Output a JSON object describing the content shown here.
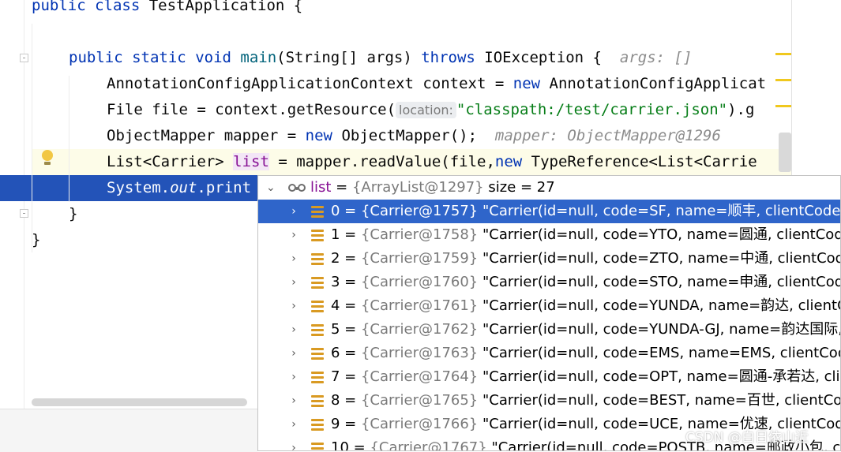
{
  "editor": {
    "line1": {
      "kw1": "public",
      "kw2": "class",
      "rest": " TestApplication {"
    },
    "line3": {
      "kw1": "public",
      "kw2": "static",
      "kw3": "void",
      "method": "main",
      "params": "(String[] args) ",
      "kw4": "throws",
      "rest": " IOException {",
      "hint": "args: []"
    },
    "line4": {
      "a": "AnnotationConfigApplicationContext context = ",
      "kw": "new",
      "b": " AnnotationConfigApplicat"
    },
    "line5": {
      "a": "File file = context.getResource(",
      "inlay": "location:",
      "str": "\"classpath:/test/carrier.json\"",
      "b": ").g"
    },
    "line6": {
      "a": "ObjectMapper mapper = ",
      "kw": "new",
      "b": " ObjectMapper();",
      "hint": "mapper: ObjectMapper@1296"
    },
    "line7": {
      "a": "List<Carrier> ",
      "var": "list",
      "b": " = mapper.readValue(file,",
      "kw": "new",
      "c": " TypeReference<List<Carrie"
    },
    "line8": {
      "a": "System.",
      "it": "out",
      "b": ".print"
    },
    "line9": "}",
    "line10": "}"
  },
  "popup": {
    "header": {
      "name": "list",
      "eq": " = ",
      "type": "{ArrayList@1297}",
      "size": "size = 27"
    },
    "rows": [
      {
        "idx": "0",
        "ref": "{Carrier@1757}",
        "value": "\"Carrier(id=null, code=SF, name=顺丰, clientCode=null,"
      },
      {
        "idx": "1",
        "ref": "{Carrier@1758}",
        "value": "\"Carrier(id=null, code=YTO, name=圆通, clientCode=nu"
      },
      {
        "idx": "2",
        "ref": "{Carrier@1759}",
        "value": "\"Carrier(id=null, code=ZTO, name=中通, clientCode=nu"
      },
      {
        "idx": "3",
        "ref": "{Carrier@1760}",
        "value": "\"Carrier(id=null, code=STO, name=申通, clientCode=nu"
      },
      {
        "idx": "4",
        "ref": "{Carrier@1761}",
        "value": "\"Carrier(id=null, code=YUNDA, name=韵达, clientCode="
      },
      {
        "idx": "5",
        "ref": "{Carrier@1762}",
        "value": "\"Carrier(id=null, code=YUNDA-GJ, name=韵达国际, clie"
      },
      {
        "idx": "6",
        "ref": "{Carrier@1763}",
        "value": "\"Carrier(id=null, code=EMS, name=EMS, clientCode=nu"
      },
      {
        "idx": "7",
        "ref": "{Carrier@1764}",
        "value": "\"Carrier(id=null, code=OPT, name=圆通-承若达, clientCo"
      },
      {
        "idx": "8",
        "ref": "{Carrier@1765}",
        "value": "\"Carrier(id=null, code=BEST, name=百世, clientCode=nu"
      },
      {
        "idx": "9",
        "ref": "{Carrier@1766}",
        "value": "\"Carrier(id=null, code=UCE, name=优速, clientCode=nu"
      },
      {
        "idx": "10",
        "ref": "{Carrier@1767}",
        "value": "\"Carrier(id=null, code=POSTB, name=邮政小包, clientC"
      }
    ]
  },
  "watermark": "CSDN @白日依山近"
}
